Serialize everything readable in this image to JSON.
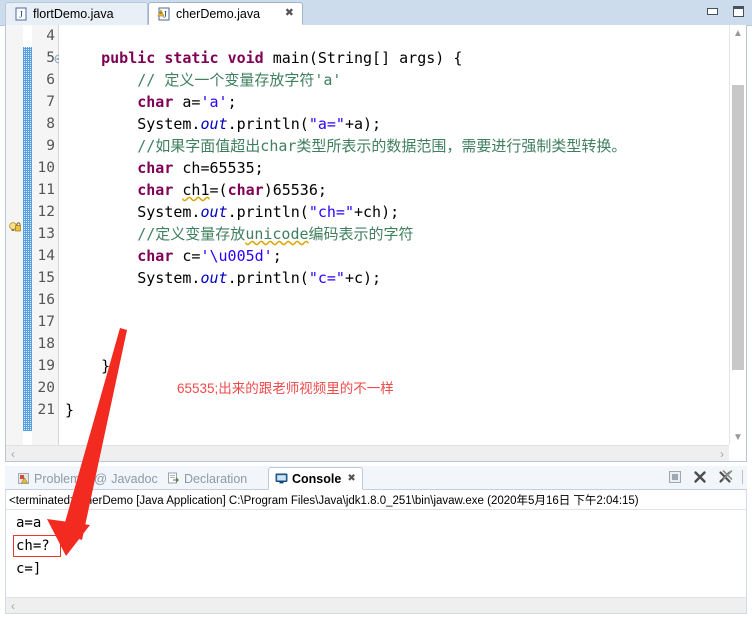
{
  "window": {
    "minimize_label": "minimize",
    "maximize_label": "maximize"
  },
  "editor_tabs": [
    {
      "label": "flortDemo.java",
      "icon": "java-file-icon",
      "active": false,
      "closable": false
    },
    {
      "label": "cherDemo.java",
      "icon": "java-file-warning-icon",
      "active": true,
      "closable": true,
      "close_glyph": "✖"
    }
  ],
  "editor": {
    "lines": [
      {
        "num": "4",
        "text": ""
      },
      {
        "num": "5",
        "text": "    public static void main(String[] args) {",
        "fold": true
      },
      {
        "num": "6",
        "text": "        // 定义一个变量存放字符'a'"
      },
      {
        "num": "7",
        "text": "        char a='a';"
      },
      {
        "num": "8",
        "text": "        System.out.println(\"a=\"+a);"
      },
      {
        "num": "9",
        "text": "        //如果字面值超出char类型所表示的数据范围，需要进行强制类型转换。"
      },
      {
        "num": "10",
        "text": "        char ch=65535;",
        "highlighted": true
      },
      {
        "num": "11",
        "text": "        char ch1=(char)65536;",
        "warning": true
      },
      {
        "num": "12",
        "text": "        System.out.println(\"ch=\"+ch);"
      },
      {
        "num": "13",
        "text": "        //定义变量存放unicode编码表示的字符"
      },
      {
        "num": "14",
        "text": "        char c='\\u005d';"
      },
      {
        "num": "15",
        "text": "        System.out.println(\"c=\"+c);"
      },
      {
        "num": "16",
        "text": ""
      },
      {
        "num": "17",
        "text": ""
      },
      {
        "num": "18",
        "text": ""
      },
      {
        "num": "19",
        "text": "    }"
      },
      {
        "num": "20",
        "text": ""
      },
      {
        "num": "21",
        "text": "}"
      }
    ],
    "annotation": "65535;出来的跟老师视频里的不一样",
    "annotation_color": "#f04a4a",
    "highlight_color": "#e8f1fe",
    "scroll_left_arrow": "‹",
    "scroll_right_arrow": "›",
    "scroll_up_arrow": "▲",
    "scroll_down_arrow": "▼"
  },
  "console": {
    "tabs": [
      {
        "label": "Problems",
        "icon": "problems-icon",
        "active": false
      },
      {
        "label": "Javadoc",
        "icon": "javadoc-at-icon",
        "active": false
      },
      {
        "label": "Declaration",
        "icon": "declaration-icon",
        "active": false
      },
      {
        "label": "Console",
        "icon": "console-icon",
        "active": true,
        "close_glyph": "✖"
      }
    ],
    "toolbar": [
      {
        "name": "terminate-button",
        "glyph": "■"
      },
      {
        "name": "remove-launch-button",
        "glyph": "✖"
      },
      {
        "name": "remove-all-terminated-button",
        "glyph": "✖"
      }
    ],
    "terminated_line": "<terminated> cherDemo [Java Application] C:\\Program Files\\Java\\jdk1.8.0_251\\bin\\javaw.exe (2020年5月16日 下午2:04:15)",
    "output": [
      {
        "text": "a=a",
        "boxed": false
      },
      {
        "text": "ch=?",
        "boxed": true,
        "box_color": "#e8362a"
      },
      {
        "text": "c=]",
        "boxed": false
      }
    ],
    "scroll_left_arrow": "‹"
  }
}
